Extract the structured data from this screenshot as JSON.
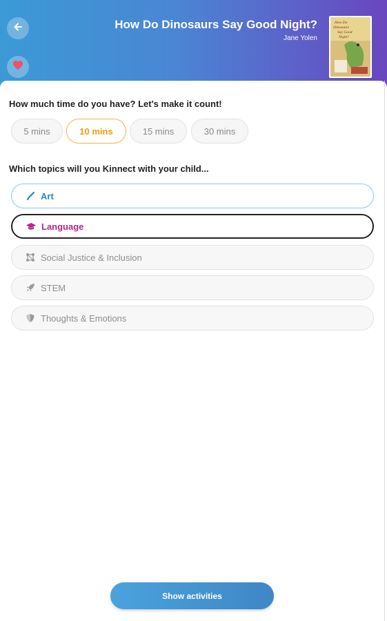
{
  "header": {
    "book_title": "How Do Dinosaurs Say Good Night?",
    "author": "Jane Yolen",
    "back_icon": "arrow-left-icon",
    "favorite_icon": "heart-icon",
    "favorite_color": "#e8556b",
    "cover_text": "How Do Dinosaurs Say Good Night?"
  },
  "time": {
    "question": "How much time do you have? Let's make it count!",
    "options": [
      "5 mins",
      "10 mins",
      "15 mins",
      "30 mins"
    ],
    "selected": "10 mins"
  },
  "topics": {
    "question": "Which topics will you Kinnect with your child...",
    "items": [
      {
        "label": "Art",
        "icon": "brush-icon",
        "state": "active",
        "color": "#2a86b8"
      },
      {
        "label": "Language",
        "icon": "graduation-cap-icon",
        "state": "focused",
        "color": "#b3268a"
      },
      {
        "label": "Social Justice & Inclusion",
        "icon": "network-icon",
        "state": "inactive",
        "color": "#8e8e8e"
      },
      {
        "label": "STEM",
        "icon": "rocket-icon",
        "state": "inactive",
        "color": "#8e8e8e"
      },
      {
        "label": "Thoughts & Emotions",
        "icon": "shield-icon",
        "state": "inactive",
        "color": "#8e8e8e"
      }
    ]
  },
  "actions": {
    "show_activities": "Show activities"
  }
}
